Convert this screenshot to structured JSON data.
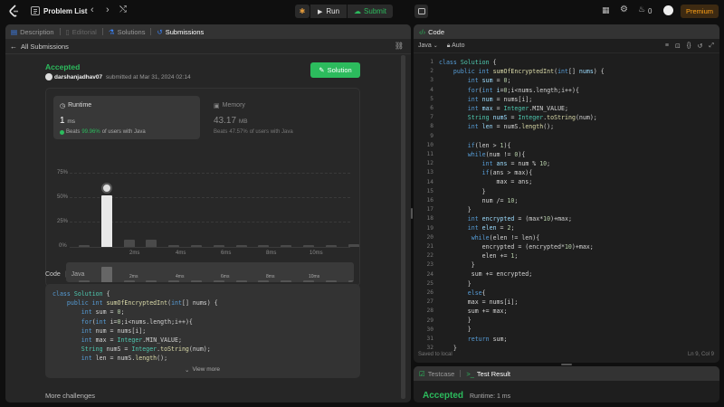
{
  "topbar": {
    "title": "Problem List",
    "run": "Run",
    "submit": "Submit",
    "points": "0",
    "premium": "Premium"
  },
  "left": {
    "tabs": [
      "Description",
      "Editorial",
      "Solutions",
      "Submissions"
    ],
    "back_label": "All Submissions",
    "status": "Accepted",
    "user": "darshanjadhav07",
    "submitted": "submitted at Mar 31, 2024 02:14",
    "solution_button": "Solution",
    "runtime": {
      "label": "Runtime",
      "value": "1",
      "unit": "ms",
      "beats_label": "Beats",
      "beats_pct": "99.96%",
      "beats_suffix": "of users with Java"
    },
    "memory": {
      "label": "Memory",
      "value": "43.17",
      "unit": "MB",
      "beats_label": "Beats",
      "beats_pct": "47.57%",
      "beats_suffix": "of users with Java"
    },
    "chart_data": {
      "type": "bar",
      "yticks": [
        "75%",
        "50%",
        "25%",
        "0%"
      ],
      "xticks": [
        "2ms",
        "4ms",
        "6ms",
        "8ms",
        "10ms"
      ],
      "values": [
        2,
        52,
        7,
        7,
        2,
        2,
        2,
        2,
        2,
        2,
        2,
        2,
        3
      ],
      "highlight_index": 1,
      "ylim": [
        0,
        75
      ],
      "mini_xticks": [
        "2ms",
        "4ms",
        "6ms",
        "8ms",
        "10ms"
      ]
    },
    "code_header": {
      "label": "Code",
      "lang": "Java"
    },
    "view_more": "View more",
    "more_challenges": "More challenges"
  },
  "right": {
    "title": "Code",
    "lang": "Java",
    "auto": "Auto",
    "saved": "Saved to local",
    "cursor": "Ln 9, Col 9"
  },
  "bottom": {
    "tab_testcase": "Testcase",
    "tab_result": "Test Result",
    "status": "Accepted",
    "runtime": "Runtime: 1 ms"
  }
}
